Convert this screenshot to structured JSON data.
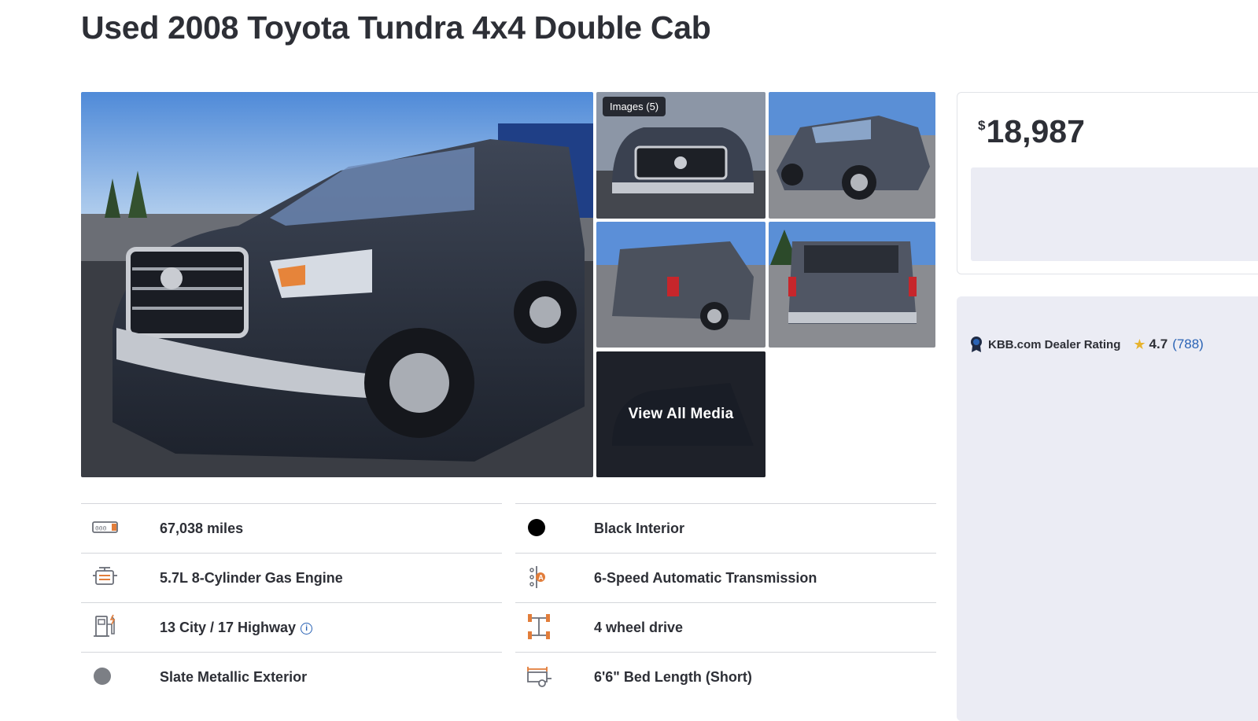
{
  "page": {
    "title": "Used 2008 Toyota Tundra 4x4 Double Cab"
  },
  "gallery": {
    "images_badge": "Images (5)",
    "view_all_label": "View All Media"
  },
  "specs": {
    "left": [
      {
        "icon": "odometer-icon",
        "label": "67,038 miles"
      },
      {
        "icon": "engine-icon",
        "label": "5.7L 8-Cylinder Gas Engine"
      },
      {
        "icon": "fuel-pump-icon",
        "label": "13 City / 17 Highway"
      },
      {
        "icon": "color-swatch-icon",
        "label": "Slate Metallic Exterior"
      }
    ],
    "right": [
      {
        "icon": "color-swatch-icon",
        "label": "Black Interior"
      },
      {
        "icon": "transmission-icon",
        "label": "6-Speed Automatic Transmission"
      },
      {
        "icon": "drivetrain-icon",
        "label": "4 wheel drive"
      },
      {
        "icon": "truck-bed-icon",
        "label": "6'6\" Bed Length (Short)"
      }
    ],
    "colors": {
      "exterior": "#7c7f85",
      "interior": "#000000",
      "accent": "#e27d3a"
    }
  },
  "price": {
    "currency": "$",
    "amount": "18,987"
  },
  "dealer": {
    "rating_label": "KBB.com Dealer Rating",
    "rating_value": "4.7",
    "rating_count": "(788)"
  },
  "theme": {
    "link": "#2a63b5",
    "star": "#e7b32e",
    "panel_bg": "#ebecf4"
  }
}
